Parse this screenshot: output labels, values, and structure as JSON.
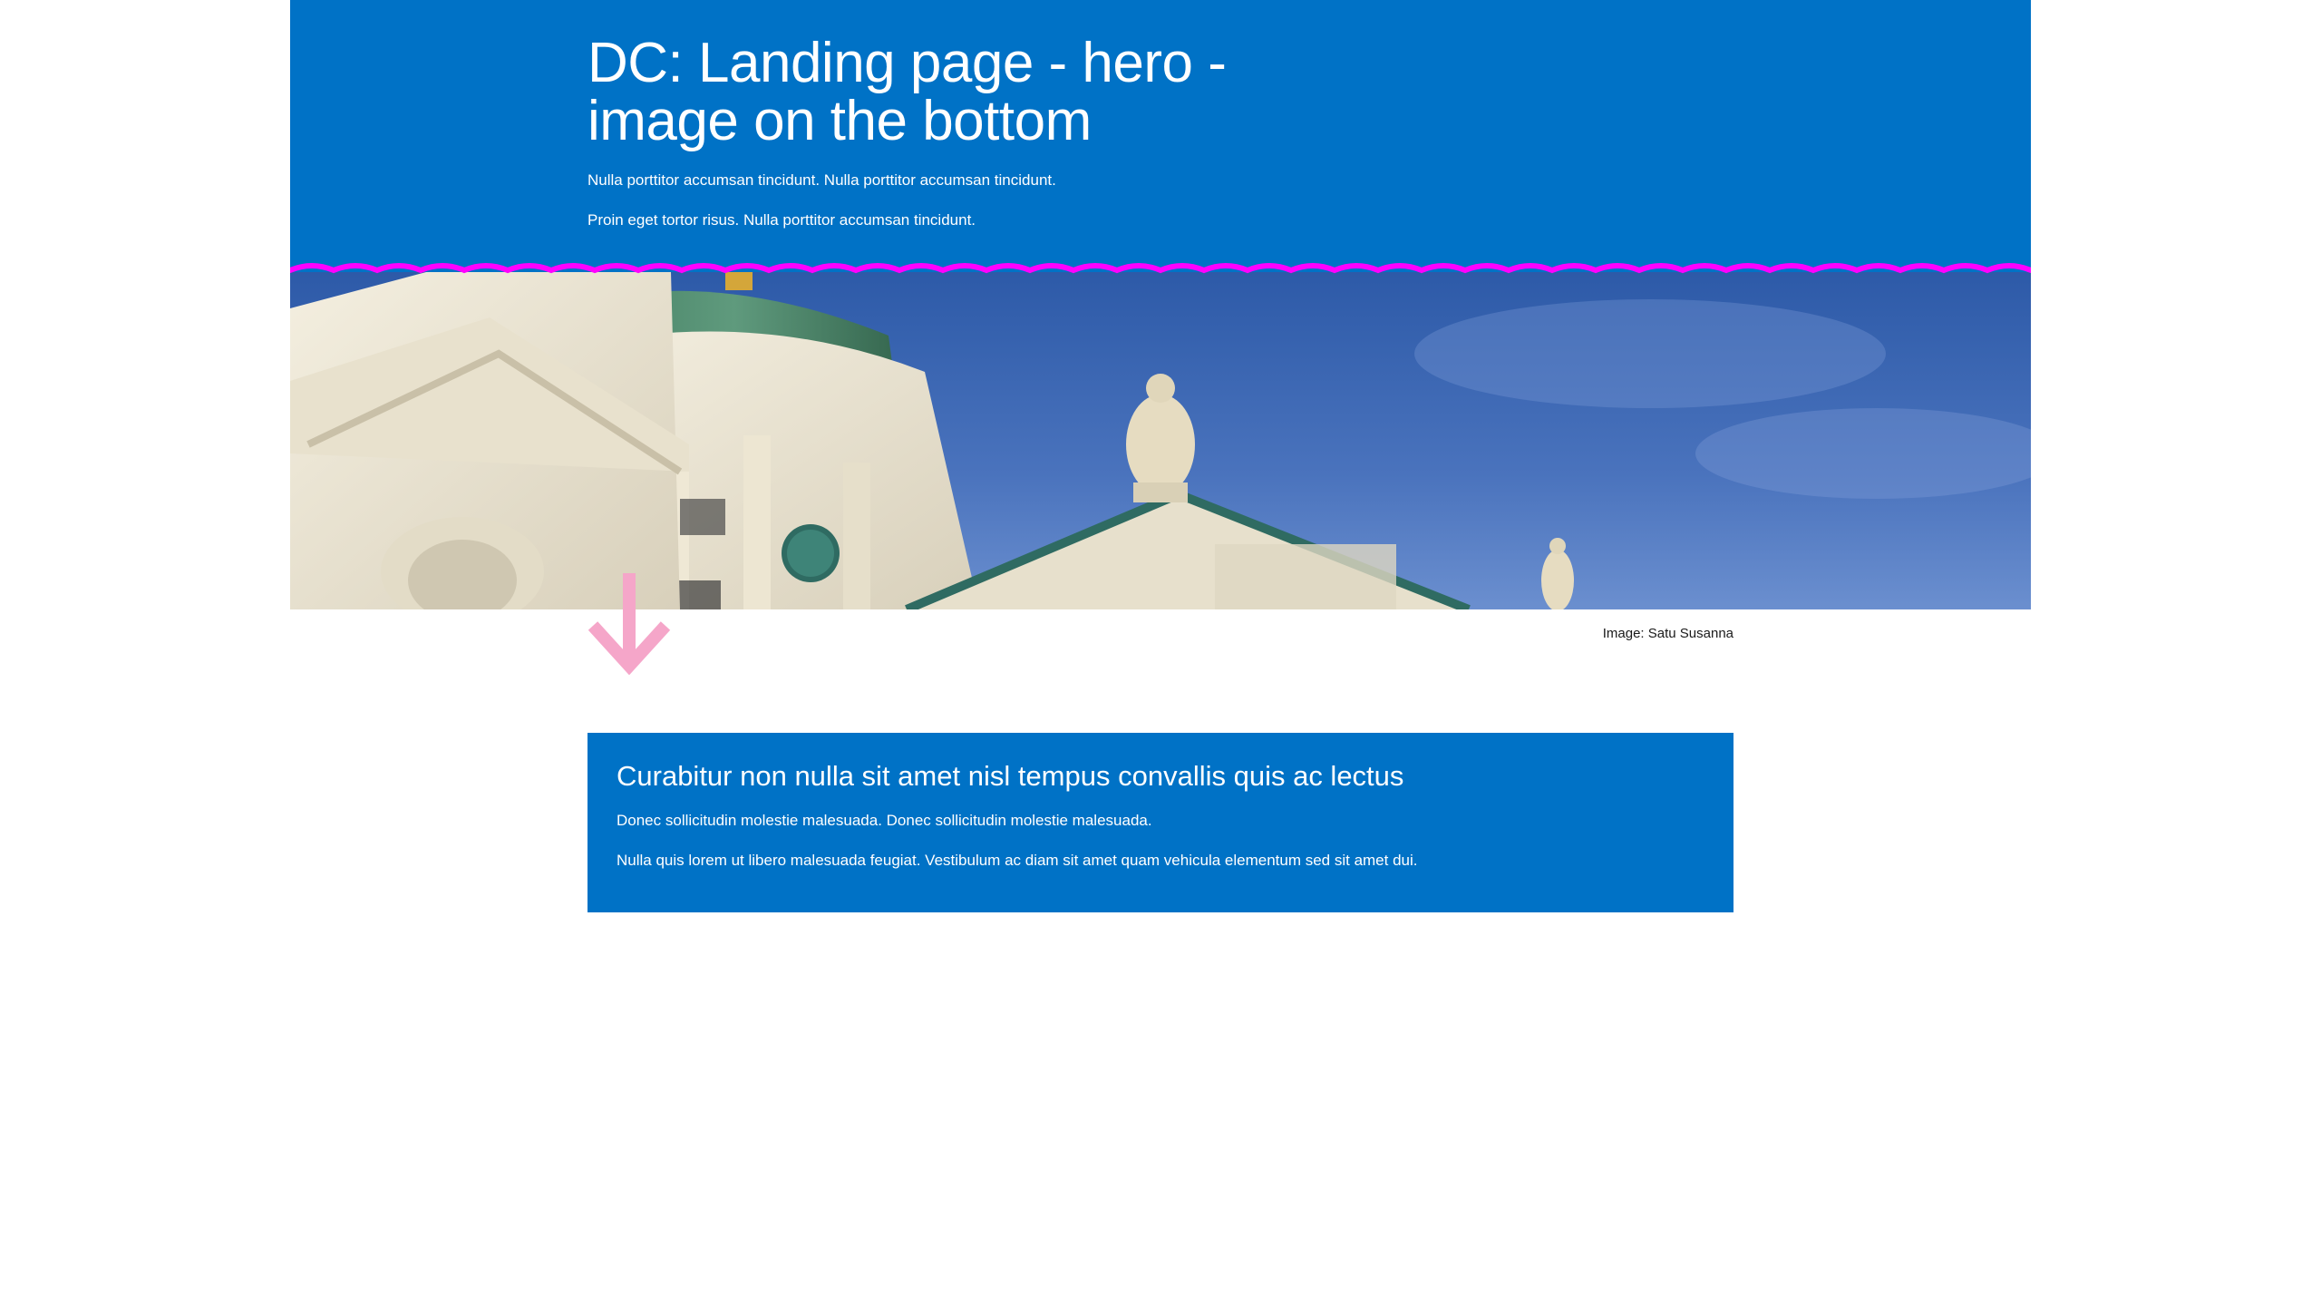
{
  "hero": {
    "title": "DC: Landing page - hero - image on the bottom",
    "paragraph_1": "Nulla porttitor accumsan tincidunt. Nulla porttitor accumsan tincidunt.",
    "paragraph_2": "Proin eget tortor risus. Nulla porttitor accumsan tincidunt.",
    "image_caption": "Image: Satu Susanna",
    "image_subject": "helsinki-cathedral-photo"
  },
  "content_box": {
    "title": "Curabitur non nulla sit amet nisl tempus convallis quis ac lectus",
    "paragraph_1": "Donec sollicitudin molestie malesuada. Donec sollicitudin molestie malesuada.",
    "paragraph_2": "Nulla quis lorem ut libero malesuada feugiat. Vestibulum ac diam sit amet quam vehicula elementum sed sit amet dui."
  },
  "icons": {
    "arrow": "arrow-down-icon",
    "wave": "wave-divider"
  },
  "colors": {
    "brand_blue": "#0072c6",
    "wave_magenta": "#ff00ff",
    "arrow_pink": "#f5a6c9",
    "text_dark": "#1a1a1a"
  }
}
